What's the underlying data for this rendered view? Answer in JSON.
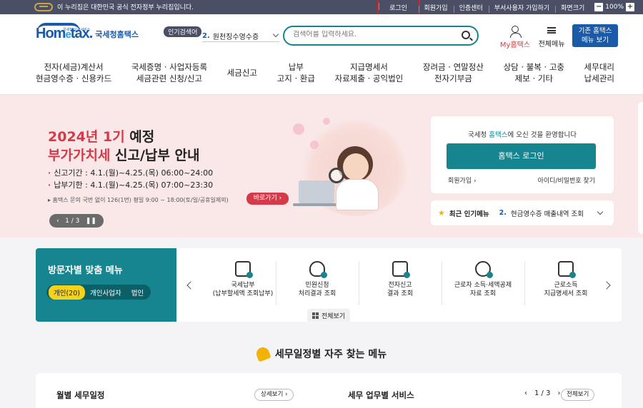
{
  "topbar": {
    "gov_notice": "이 누리집은 대한민국 공식 전자정부 누리집입니다.",
    "links": [
      "로그인",
      "회원가입",
      "인증센터",
      "부서사용자 가입하기",
      "화면크기"
    ],
    "zoom_minus": "−",
    "zoom_value": "100%",
    "zoom_plus": "+"
  },
  "header": {
    "logo_small": "국세청 납세서비스",
    "logo_brand_a": "Hom",
    "logo_brand_b": "e",
    "logo_brand_c": "tax.",
    "logo_kor": "국세청홈택스",
    "popular_tag": "인기검색어",
    "popular_num": "2.",
    "popular_value": "원천징수영수증",
    "search_placeholder": "검색어를 입력하세요.",
    "my_label": "My홈택스",
    "allmenu_label": "전체메뉴",
    "oldhome_line1": "기존 홈택스",
    "oldhome_line2": "메뉴 보기"
  },
  "gnb": [
    "전자(세금)계산서\n현금영수증 · 신용카드",
    "국세증명 · 사업자등록\n세금관련 신청/신고",
    "세금신고",
    "납부\n고지 · 환급",
    "지급명세서\n자료제출 · 공익법인",
    "장려금 · 연말정산\n전자기부금",
    "상담 · 불복 · 고충\n제보 · 기타",
    "세무대리\n납세관리"
  ],
  "hero": {
    "t1_red": "2024년 1기",
    "t1_black": " 예정",
    "t2_red": "부가가치세",
    "t2_black": " 신고/납부 안내",
    "line1": "신고기간 : 4.1.(월)~4.25.(목) 06:00~24:00",
    "line2": "납부기한 : 4.1.(월)~4.25.(목) 07:00~23:30",
    "note": "▸ 홈택스 문의 국번 없이 126(1번) 평일 9:00 ~ 18:00(토/일/공휴일제외)",
    "go_button": "바로가기  ›",
    "pager_prev": "‹",
    "pager_text": "1 / 3",
    "pager_next": "›",
    "pager_pause": "❚❚"
  },
  "login": {
    "welcome_pre": "국세청 ",
    "welcome_hl": "홈택스",
    "welcome_post": "에 오신 것을 환영합니다",
    "button": "홈택스 로그인",
    "signup": "회원가입  ›",
    "find": "아이디/비밀번호 찾기"
  },
  "recent": {
    "title": "최근 인기메뉴",
    "num": "2.",
    "value": "현금영수증 매출내역 조회"
  },
  "visitor": {
    "title": "방문자별 맞춤 메뉴",
    "tabs": [
      "개인(20)",
      "개인사업자",
      "법인"
    ],
    "services": [
      {
        "l1": "국세납부",
        "l2": "(납부할세액 조회납부)"
      },
      {
        "l1": "민원신청",
        "l2": "처리결과 조회"
      },
      {
        "l1": "전자신고",
        "l2": "결과 조회"
      },
      {
        "l1": "근로자 소득·세액공제",
        "l2": "자료 조회"
      },
      {
        "l1": "근로소득",
        "l2": "지급명세서 조회"
      }
    ],
    "all_view": "전체보기"
  },
  "schedule": {
    "title": "세무일정별 자주 찾는 메뉴"
  },
  "bottom": {
    "monthly": "월별 세무일정",
    "detail": "상세보기  ›",
    "service": "세무 업무별 서비스",
    "prev": "‹",
    "page": "1 / 3",
    "next": "›",
    "all": "전체보기"
  },
  "colors": {
    "accent": "#16858f",
    "brand_blue": "#1a5aa8",
    "hero_red": "#d63a4a",
    "topbar": "#4b4f66",
    "hero_bg": "#fae8e8"
  }
}
